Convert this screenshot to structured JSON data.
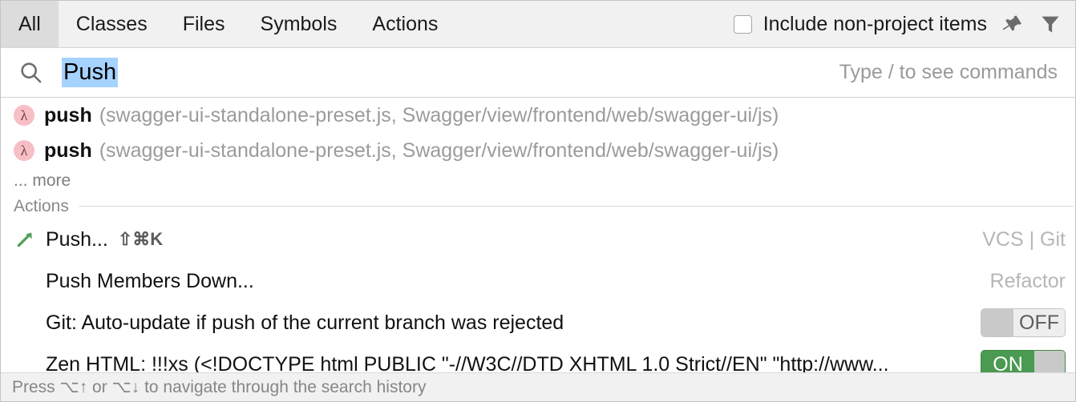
{
  "tabs": [
    {
      "label": "All",
      "selected": true
    },
    {
      "label": "Classes",
      "selected": false
    },
    {
      "label": "Files",
      "selected": false
    },
    {
      "label": "Symbols",
      "selected": false
    },
    {
      "label": "Actions",
      "selected": false
    }
  ],
  "toolbar": {
    "include_non_project_label": "Include non-project items",
    "include_non_project_checked": false,
    "pin_icon": "pin-icon",
    "filter_icon": "filter-funnel-icon"
  },
  "search": {
    "icon": "search-icon",
    "value": "Push",
    "hint": "Type / to see commands",
    "selected": true
  },
  "symbol_results": [
    {
      "icon": "lambda-function-icon",
      "glyph": "λ",
      "name": "push",
      "location": "(swagger-ui-standalone-preset.js, Swagger/view/frontend/web/swagger-ui/js)"
    },
    {
      "icon": "lambda-function-icon",
      "glyph": "λ",
      "name": "push",
      "location": "(swagger-ui-standalone-preset.js, Swagger/view/frontend/web/swagger-ui/js)"
    }
  ],
  "more_label": "... more",
  "actions_section": {
    "title": "Actions"
  },
  "actions": [
    {
      "icon": "push-arrow-icon",
      "label": "Push...",
      "shortcut": "⇧⌘K",
      "group": "VCS | Git",
      "toggle": null
    },
    {
      "icon": null,
      "label": "Push Members Down...",
      "shortcut": "",
      "group": "Refactor",
      "toggle": null
    },
    {
      "icon": null,
      "label": "Git: Auto-update if push of the current branch was rejected",
      "shortcut": "",
      "group": "",
      "toggle": "OFF"
    },
    {
      "icon": null,
      "label": "Zen HTML: !!!xs (<!DOCTYPE html PUBLIC \"-//W3C//DTD XHTML 1.0 Strict//EN\" \"http://www...",
      "shortcut": "",
      "group": "",
      "toggle": "ON"
    }
  ],
  "footer": {
    "text": "Press ⌥↑ or ⌥↓ to navigate through the search history"
  },
  "colors": {
    "tab_selected_bg": "#dcdcdc",
    "toolbar_bg": "#f1f1f1",
    "selection_blue": "#a6d2ff",
    "lambda_pink": "#f7bec5",
    "toggle_on_green": "#4a9a51",
    "muted_text": "#9b9b9b"
  }
}
